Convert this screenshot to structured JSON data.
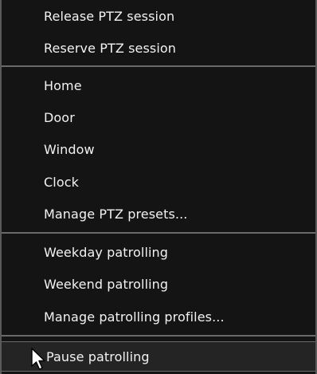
{
  "menu": {
    "groups": [
      {
        "items": [
          {
            "label": "Release PTZ session"
          },
          {
            "label": "Reserve PTZ session"
          }
        ]
      },
      {
        "items": [
          {
            "label": "Home"
          },
          {
            "label": "Door"
          },
          {
            "label": "Window"
          },
          {
            "label": "Clock"
          },
          {
            "label": "Manage PTZ presets..."
          }
        ]
      },
      {
        "items": [
          {
            "label": "Weekday patrolling"
          },
          {
            "label": "Weekend patrolling"
          },
          {
            "label": "Manage patrolling profiles..."
          }
        ]
      },
      {
        "items": [
          {
            "label": "Pause patrolling",
            "state": "hovered"
          }
        ]
      }
    ]
  },
  "icons": {
    "cursor": "mouse-pointer-icon"
  },
  "colors": {
    "background": "#141414",
    "text": "#f2f2f2",
    "separator": "#6a6a6a",
    "hover": "#242424"
  }
}
